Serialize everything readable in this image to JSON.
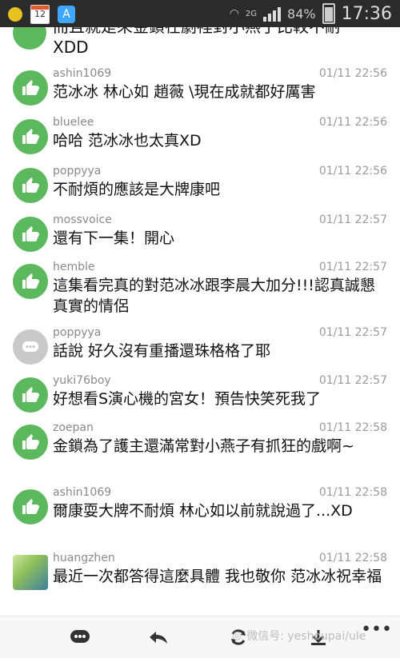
{
  "status_bar": {
    "calendar_day": "12",
    "shield_letter": "A",
    "network": "2G",
    "battery_percent": "84%",
    "time": "17:36",
    "icons": [
      "weather-sun-icon",
      "calendar-icon",
      "shield-app-icon",
      "wifi-icon",
      "signal-icon",
      "battery-icon"
    ]
  },
  "partial_top": {
    "text": "而且就是來金鎖在劇裡對小燕子比較不耐",
    "text2": "XDD"
  },
  "comments": [
    {
      "user": "ashin1069",
      "time": "01/11 22:56",
      "text": "范冰冰 林心如 趙薇 \\現在成就都好厲害",
      "avatar": "thumb"
    },
    {
      "user": "bluelee",
      "time": "01/11 22:56",
      "text": "哈哈 范冰冰也太真XD",
      "avatar": "thumb"
    },
    {
      "user": "poppyya",
      "time": "01/11 22:56",
      "text": "不耐煩的應該是大牌康吧",
      "avatar": "thumb"
    },
    {
      "user": "mossvoice",
      "time": "01/11 22:57",
      "text": "還有下一集！開心",
      "avatar": "thumb"
    },
    {
      "user": "hemble",
      "time": "01/11 22:57",
      "text": "這集看完真的對范冰冰跟李晨大加分!!!認真誠懇真實的情侶",
      "avatar": "thumb"
    },
    {
      "user": "poppyya",
      "time": "01/11 22:57",
      "text": "話說 好久沒有重播還珠格格了耶",
      "avatar": "chat"
    },
    {
      "user": "yuki76boy",
      "time": "01/11 22:57",
      "text": "好想看S演心機的宮女！預告快笑死我了",
      "avatar": "thumb"
    },
    {
      "user": "zoepan",
      "time": "01/11 22:58",
      "text": "金鎖為了護主還滿常對小燕子有抓狂的戲啊~",
      "avatar": "thumb"
    },
    {
      "user": "ashin1069",
      "time": "01/11 22:58",
      "text": "爾康耍大牌不耐煩 林心如以前就說過了...XD",
      "avatar": "thumb"
    },
    {
      "user": "huangzhen",
      "time": "01/11 22:58",
      "text": "最近一次都答得這麼具體 我也敬你 范冰冰祝幸福",
      "avatar": "photo"
    }
  ],
  "bottom_bar": {
    "watermark": "微信号: yeshoupai/ule",
    "buttons": [
      "comment-icon",
      "reply-icon",
      "refresh-icon",
      "download-icon"
    ],
    "more_label": "•••"
  },
  "colors": {
    "like_green": "#5cb85c",
    "status_bar_bg": "#2b2b2b",
    "gray_avatar": "#c9c9c9"
  }
}
